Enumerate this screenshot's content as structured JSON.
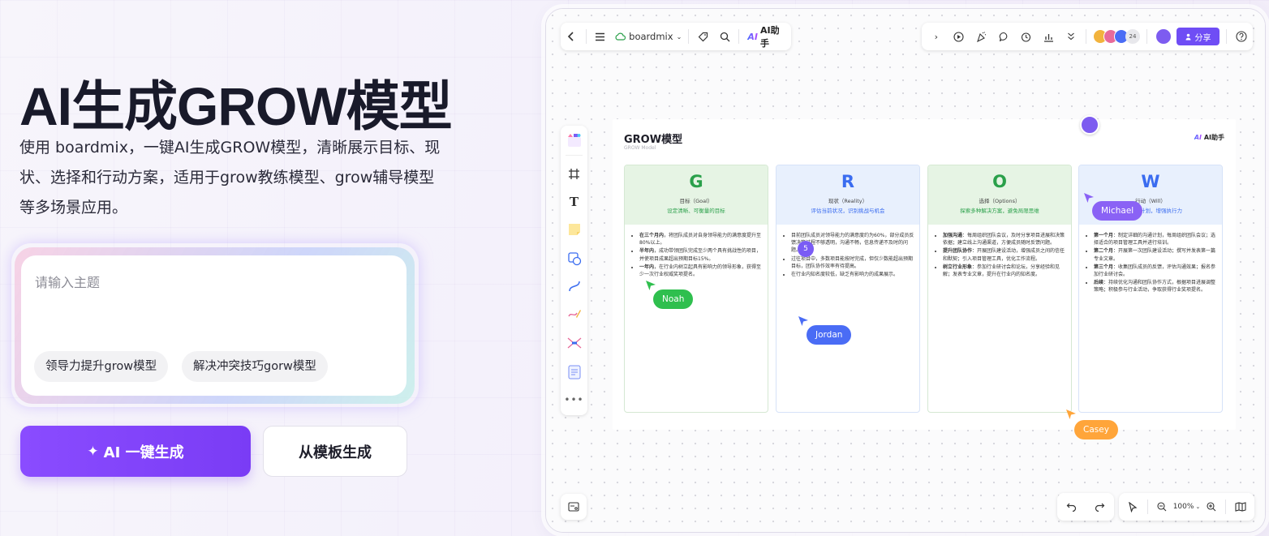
{
  "hero": {
    "title": "AI生成GROW模型",
    "description": "使用 boardmix，一键AI生成GROW模型，清晰展示目标、现状、选择和行动方案，适用于grow教练模型、grow辅导模型等多场景应用。"
  },
  "input": {
    "placeholder": "请输入主题",
    "chips": [
      "领导力提升grow模型",
      "解决冲突技巧gorw模型"
    ]
  },
  "actions": {
    "ai_generate": "AI 一键生成",
    "from_template": "从模板生成"
  },
  "app": {
    "brand": "boardmix",
    "ai_assistant": "AI助手",
    "collaborator_count": "24",
    "share_label": "分享",
    "zoom": "100%",
    "board": {
      "title": "GROW模型",
      "subtitle": "GROW Model",
      "ai_badge": "AI助手",
      "columns": [
        {
          "letter": "G",
          "name": "目标（Goal）",
          "tagline": "设定清晰、可衡量的目标",
          "color": "#2aa04a",
          "head_bg": "#e6f4e4",
          "items": [
            {
              "strong": "在三个月内",
              "text": "，将团队成员对自身领导能力的满意度提升至80%以上。"
            },
            {
              "strong": "半年内",
              "text": "，成功带领团队完成至少两个具有挑战性的项目，并使项目成果超出预期目标15%。"
            },
            {
              "strong": "一年内",
              "text": "，在行业内树立起具有影响力的领导形象，获得至少一次行业权威奖项提名。"
            }
          ]
        },
        {
          "letter": "R",
          "name": "现状（Reality）",
          "tagline": "评估当前状况，识别挑战与机会",
          "color": "#3a6cf0",
          "head_bg": "#e8f0fd",
          "items": [
            {
              "strong": "",
              "text": "目前团队成员对领导能力的满意度约为60%，部分成员反馈决策过程不够透明，沟通不畅，信息传递不及时的问题。"
            },
            {
              "strong": "",
              "text": "过往项目中，多数项目能按时完成，但仅少数能超出预期目标，团队协作效率有待提高。"
            },
            {
              "strong": "",
              "text": "在行业内知名度较低，缺乏有影响力的成果展示。"
            }
          ]
        },
        {
          "letter": "O",
          "name": "选择（Options）",
          "tagline": "探索多种解决方案，避免局限思维",
          "color": "#2aa04a",
          "head_bg": "#e6f4e4",
          "items": [
            {
              "strong": "加强沟通",
              "text": "：每周组织团队会议，及时分享项目进展和决策依据；建立线上沟通渠道，方便成员随时反馈问题。"
            },
            {
              "strong": "提升团队协作",
              "text": "：开展团队建设活动，增强成员之间的信任和默契；引入项目管理工具，优化工作流程。"
            },
            {
              "strong": "树立行业形象",
              "text": "：参加行业研讨会和论坛，分享经验和见解；发表专业文章，提升在行业内的知名度。"
            }
          ]
        },
        {
          "letter": "W",
          "name": "行动（Will）",
          "tagline": "制定行动计划，增强执行力",
          "color": "#3a6cf0",
          "head_bg": "#e8f0fd",
          "items": [
            {
              "strong": "第一个月",
              "text": "：制定详细的沟通计划，每周组织团队会议；选择适合的项目管理工具并进行培训。"
            },
            {
              "strong": "第二个月",
              "text": "：开展第一次团队建设活动；撰写并发表第一篇专业文章。"
            },
            {
              "strong": "第三个月",
              "text": "：收集团队成员的反馈，评估沟通效果；报名参加行业研讨会。"
            },
            {
              "strong": "后续",
              "text": "：持续优化沟通和团队协作方式，根据项目进展调整策略；积极参与行业活动，争取获得行业奖项提名。"
            }
          ]
        }
      ]
    },
    "cursors": [
      {
        "name": "Noah",
        "color": "#2fbf4e"
      },
      {
        "name": "Jordan",
        "color": "#4a6cf5"
      },
      {
        "name": "Michael",
        "color": "#8a62f5"
      },
      {
        "name": "Casey",
        "color": "#ffa53a"
      }
    ],
    "comment_count": "5"
  }
}
